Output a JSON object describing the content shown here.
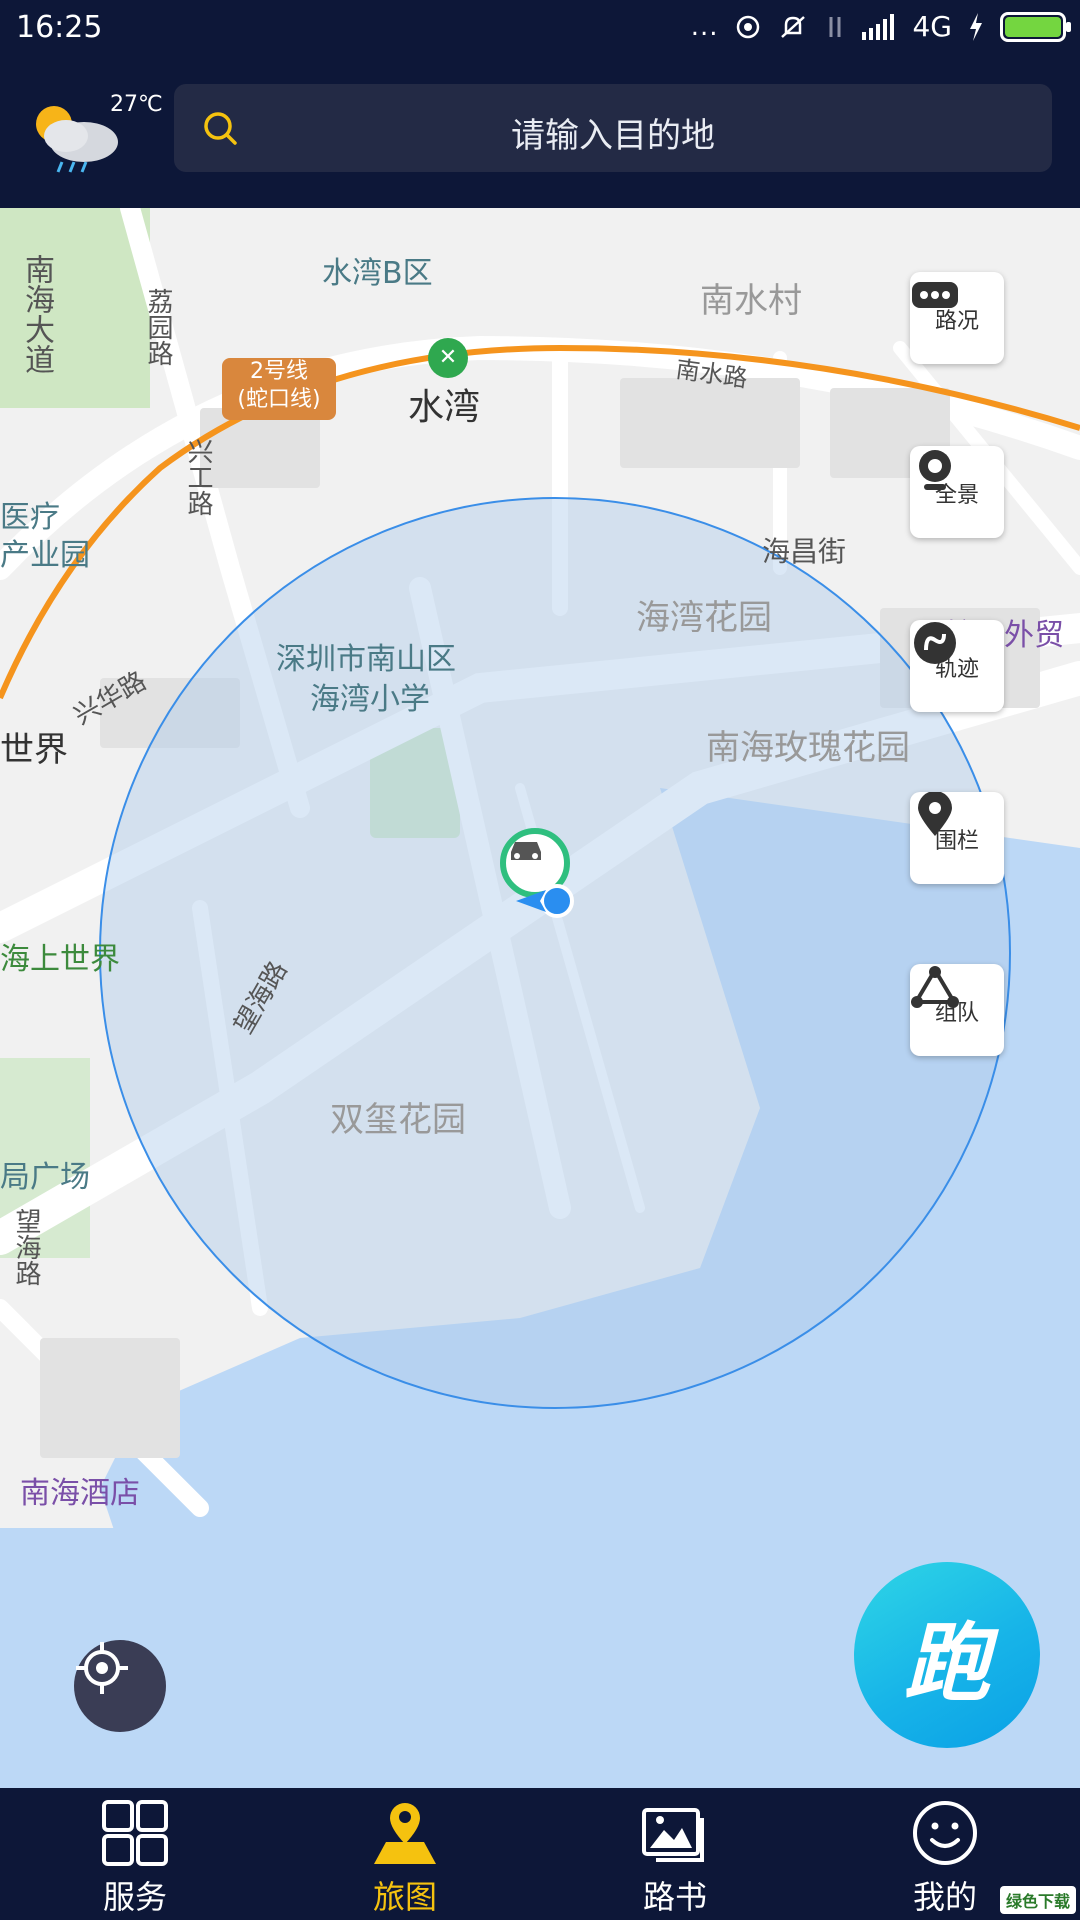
{
  "status_bar": {
    "time": "16:25",
    "network": "4G",
    "dots": "..."
  },
  "header": {
    "temperature": "27℃",
    "weather_icon": "rain-cloud-sun-icon",
    "search_placeholder": "请输入目的地"
  },
  "map": {
    "labels": {
      "shuiwan_b": "水湾B区",
      "nanshui_village": "南水村",
      "nanhai_road": "南海大道",
      "liyuan_road": "荔园路",
      "metro_line": "2号线",
      "metro_line_sub": "(蛇口线)",
      "shuiwan": "水湾",
      "nanshui_road": "南水路",
      "xingong_road": "兴华路",
      "medical": "医疗",
      "industrial_park": "产业园",
      "haichang_street": "海昌街",
      "haiwan_garden": "海湾花园",
      "shekou_trade": "蛇口外贸",
      "school_1": "深圳市南山区",
      "school_2": "海湾小学",
      "xinghua_road": "兴华路",
      "world": "世界",
      "nanhai_rose_garden": "南海玫瑰花园",
      "sea_world": "海上世界",
      "wanghai_road": "望海路",
      "shuangxi_garden": "双玺花园",
      "square": "局广场",
      "wanghai_road_2": "望海路",
      "nanhai_hotel": "南海酒店",
      "xinggong": "兴工路"
    },
    "tools": [
      {
        "label": "路况",
        "icon": "traffic-dots-icon"
      },
      {
        "label": "全景",
        "icon": "camera-icon"
      },
      {
        "label": "轨迹",
        "icon": "track-icon"
      },
      {
        "label": "围栏",
        "icon": "location-pin-icon"
      },
      {
        "label": "组队",
        "icon": "team-icon"
      }
    ],
    "run_button": "跑",
    "accent": "#17b4e8"
  },
  "nav": [
    {
      "label": "服务",
      "icon": "grid-icon"
    },
    {
      "label": "旅图",
      "icon": "map-pin-icon"
    },
    {
      "label": "路书",
      "icon": "picture-icon"
    },
    {
      "label": "我的",
      "icon": "smiley-icon"
    }
  ],
  "watermark": "绿色下载"
}
